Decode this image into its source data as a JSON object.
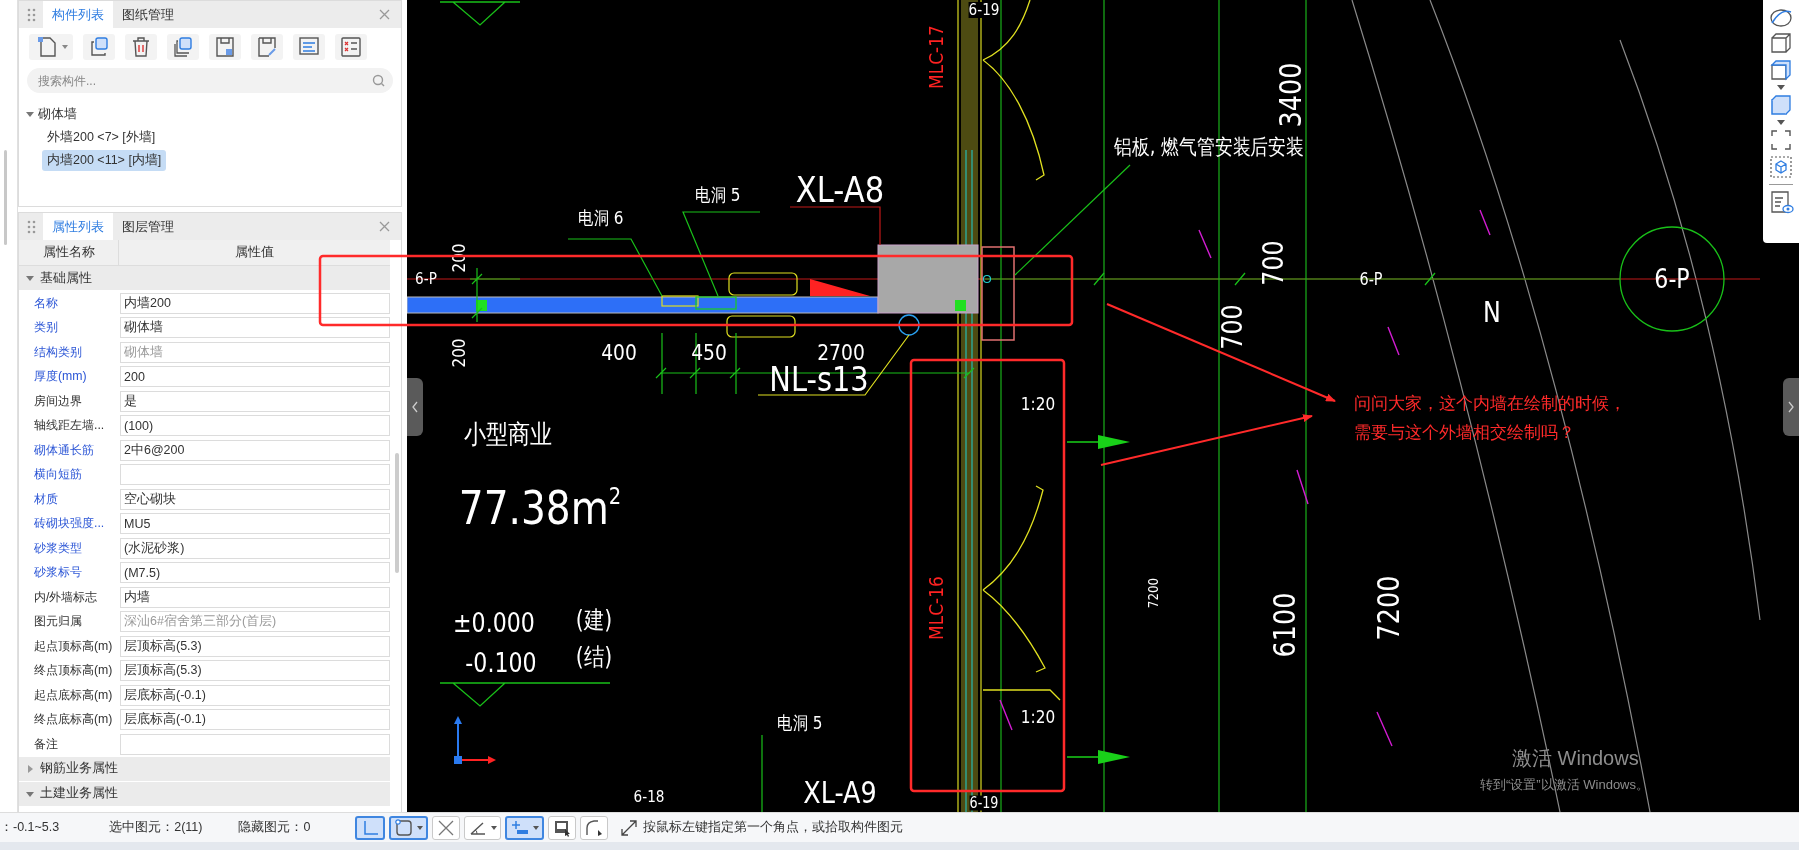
{
  "component_panel": {
    "tabs": [
      {
        "label": "构件列表",
        "selected": true
      },
      {
        "label": "图纸管理",
        "selected": false
      }
    ],
    "search": {
      "placeholder": "搜索构件..."
    },
    "tree": [
      {
        "label": "砌体墙",
        "expanded": true,
        "children": [
          {
            "label": "外墙200 <7> [外墙]",
            "selected": false
          },
          {
            "label": "内墙200 <11> [内墙]",
            "selected": true
          }
        ]
      }
    ]
  },
  "property_panel": {
    "tabs": [
      {
        "label": "属性列表",
        "selected": true
      },
      {
        "label": "图层管理",
        "selected": false
      }
    ],
    "columns": [
      "属性名称",
      "属性值"
    ],
    "groups": [
      {
        "label": "基础属性",
        "expanded": true,
        "rows": [
          {
            "name": "名称",
            "value": "内墙200",
            "public": true,
            "disabled": false
          },
          {
            "name": "类别",
            "value": "砌体墙",
            "public": true,
            "disabled": false
          },
          {
            "name": "结构类别",
            "value": "砌体墙",
            "public": true,
            "disabled": true
          },
          {
            "name": "厚度(mm)",
            "value": "200",
            "public": true,
            "disabled": false
          },
          {
            "name": "房间边界",
            "value": "是",
            "public": false,
            "disabled": false
          },
          {
            "name": "轴线距左墙...",
            "value": "(100)",
            "public": false,
            "disabled": false
          },
          {
            "name": "砌体通长筋",
            "value": "2中6@200",
            "public": true,
            "disabled": false
          },
          {
            "name": "横向短筋",
            "public": true,
            "disabled": false
          },
          {
            "name": "材质",
            "value": "空心砌块",
            "public": true,
            "disabled": false
          },
          {
            "name": "砖砌块强度...",
            "value": "MU5",
            "public": true,
            "disabled": false
          },
          {
            "name": "砂浆类型",
            "value": "(水泥砂浆)",
            "public": true,
            "disabled": false
          },
          {
            "name": "砂浆标号",
            "value": "(M7.5)",
            "public": true,
            "disabled": false
          },
          {
            "name": "内/外墙标志",
            "value": "内墙",
            "public": false,
            "disabled": false
          },
          {
            "name": "图元归属",
            "value": "深汕6#宿舍第三部分(首层)",
            "public": false,
            "disabled": true
          },
          {
            "name": "起点顶标高(m)",
            "value": "层顶标高(5.3)",
            "public": false,
            "disabled": false
          },
          {
            "name": "终点顶标高(m)",
            "value": "层顶标高(5.3)",
            "public": false,
            "disabled": false
          },
          {
            "name": "起点底标高(m)",
            "value": "层底标高(-0.1)",
            "public": false,
            "disabled": false
          },
          {
            "name": "终点底标高(m)",
            "value": "层底标高(-0.1)",
            "public": false,
            "disabled": false
          },
          {
            "name": "备注",
            "public": false,
            "disabled": false
          }
        ]
      },
      {
        "label": "钢筋业务属性",
        "expanded": false
      },
      {
        "label": "土建业务属性",
        "expanded": true
      }
    ]
  },
  "drawing": {
    "labels": [
      "6-19",
      "MLC-17",
      "3400",
      "铝板, 燃气管安装后安装",
      "XL-A8",
      "电洞 5",
      "电洞 6",
      "6-P",
      "200",
      "200",
      "400",
      "450",
      "2700",
      "NL-s13",
      "700",
      "700",
      "6-P",
      "6-P",
      "N",
      "1:20",
      "小型商业",
      "77.38m$^{2}$",
      "±0.000",
      "(建)",
      "-0.100",
      "(结)",
      "MLC-16",
      "7200",
      "6100",
      "7200",
      "1:20",
      "电洞 5",
      "6-18",
      "XL-A9",
      "6-19"
    ]
  },
  "annotation": {
    "text": "问问大家，这个内墙在绘制的时候，需要与这个外墙相交绘制吗？"
  },
  "activation_notice": {
    "title": "激活 Windows",
    "subtitle": "转到“设置”以激活 Windows。"
  },
  "status_bar": {
    "elevation": "：-0.1~5.3",
    "selected_count": "选中图元：2(11)",
    "hidden_count": "隐藏图元：0",
    "tools": [
      {
        "kind": "ortho",
        "on": true
      },
      {
        "kind": "snap-box",
        "on": true
      },
      {
        "kind": "cross",
        "on": false
      },
      {
        "kind": "angle",
        "on": false
      },
      {
        "kind": "dimension",
        "on": true
      },
      {
        "kind": "display",
        "on": false
      },
      {
        "kind": "arc",
        "on": false
      }
    ],
    "hint": "按鼠标左键指定第一个角点，或拾取构件图元"
  }
}
